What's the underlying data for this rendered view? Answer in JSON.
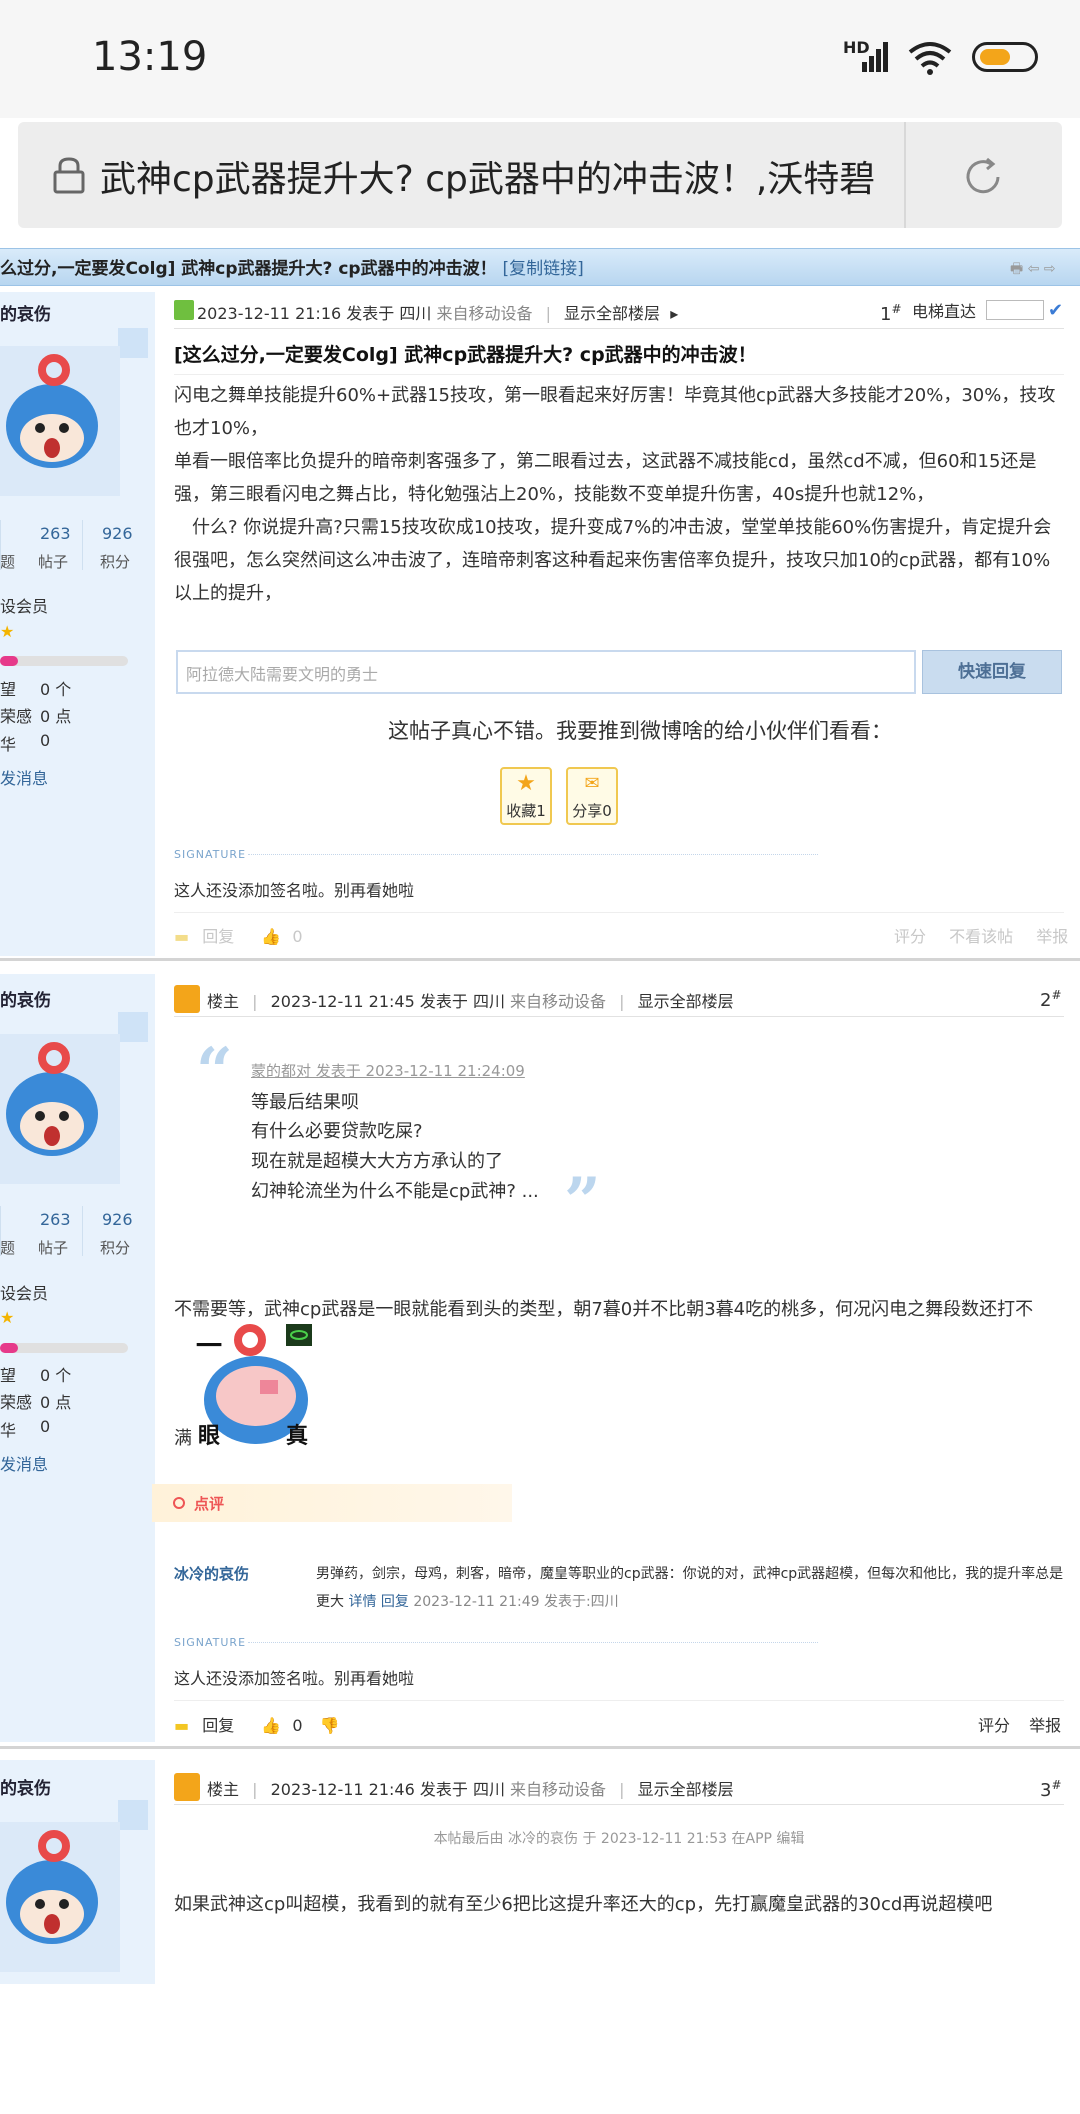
{
  "status_bar": {
    "time": "13:19",
    "network": "HD"
  },
  "browser": {
    "url_title": "武神cp武器提升大? cp武器中的冲击波！,沃特碧",
    "lock_icon": "lock-icon",
    "reload_icon": "reload-icon"
  },
  "title_bar": {
    "title": "么过分,一定要发Colg] 武神cp武器提升大? cp武器中的冲击波！",
    "copy_link": "[复制链接]"
  },
  "post1": {
    "user": {
      "name": "的哀伤",
      "posts_count": "263",
      "posts_label": "帖子",
      "points_count": "926",
      "points_label": "积分",
      "stat_left_label": "题",
      "member": "设会员",
      "row1_label": "望",
      "row1_value": "0 个",
      "row2_label": "荣感",
      "row2_value": "0 点",
      "row3_label": "华",
      "row3_value": "0",
      "send_message": "发消息"
    },
    "meta": {
      "datetime": "2023-12-11 21:16 发表于 四川",
      "device": "来自移动设备",
      "show_all": "显示全部楼层",
      "floor": "1",
      "floor_mark": "#",
      "jump_label": "电梯直达"
    },
    "title": "[这么过分,一定要发Colg] 武神cp武器提升大? cp武器中的冲击波！",
    "paragraphs": [
      "闪电之舞单技能提升60%+武器15技攻，第一眼看起来好厉害！毕竟其他cp武器大多技能才20%，30%，技攻也才10%，",
      "单看一眼倍率比负提升的暗帝刺客强多了，第二眼看过去，这武器不减技能cd，虽然cd不减，但60和15还是强，第三眼看闪电之舞占比，特化勉强沾上20%，技能数不变单提升伤害，40s提升也就12%，",
      "　什么? 你说提升高?只需15技攻砍成10技攻，提升变成7%的冲击波，堂堂单技能60%伤害提升，肯定提升会很强吧，怎么突然间这么冲击波了，连暗帝刺客这种看起来伤害倍率负提升，技攻只加10的cp武器，都有10%以上的提升，"
    ],
    "quick_reply": {
      "placeholder": "阿拉德大陆需要文明的勇士",
      "button": "快速回复"
    },
    "share_prompt": "这帖子真心不错。我要推到微博啥的给小伙伴们看看：",
    "favorite_label": "收藏1",
    "share_label": "分享0",
    "signature_label": "SIGNATURE",
    "signature": "这人还没添加签名啦。别再看她啦",
    "actions": {
      "reply": "回复",
      "likes": "0",
      "rate": "评分",
      "ignore": "不看该帖",
      "report": "举报"
    }
  },
  "post2": {
    "user": {
      "name": "的哀伤",
      "posts_count": "263",
      "posts_label": "帖子",
      "points_count": "926",
      "points_label": "积分",
      "stat_left_label": "题",
      "member": "设会员",
      "row1_label": "望",
      "row1_value": "0 个",
      "row2_label": "荣感",
      "row2_value": "0 点",
      "row3_label": "华",
      "row3_value": "0",
      "send_message": "发消息"
    },
    "meta": {
      "role": "楼主",
      "datetime": "2023-12-11 21:45 发表于 四川",
      "device": "来自移动设备",
      "show_all": "显示全部楼层",
      "floor": "2",
      "floor_mark": "#"
    },
    "quote": {
      "header": "蒙的都对 发表于 2023-12-11 21:24:09",
      "lines": [
        "等最后结果呗",
        "有什么必要贷款吃屎?",
        "现在就是超模大大方方承认的了",
        "幻神轮流坐为什么不能是cp武神? ..."
      ]
    },
    "body": "不需要等，武神cp武器是一眼就能看到头的类型，朝7暮0并不比朝3暮4吃的桃多，何况闪电之舞段数还打不",
    "body_tail": "满",
    "sticker_text": {
      "left": "一",
      "mid": "眼",
      "right": "真"
    },
    "dianping_label": "点评",
    "comment": {
      "user": "冰冷的哀伤",
      "text": "男弹药，剑宗，母鸡，刺客，暗帝，魔皇等职业的cp武器：你说的对，武神cp武器超模，但每次和他比，我的提升率总是更",
      "text_tail": "大",
      "detail": "详情",
      "reply": "回复",
      "time": "2023-12-11 21:49 发表于:四川"
    },
    "signature_label": "SIGNATURE",
    "signature": "这人还没添加签名啦。别再看她啦",
    "actions": {
      "reply": "回复",
      "likes": "0",
      "rate": "评分",
      "report": "举报"
    }
  },
  "post3": {
    "user": {
      "name": "的哀伤"
    },
    "meta": {
      "role": "楼主",
      "datetime": "2023-12-11 21:46 发表于 四川",
      "device": "来自移动设备",
      "show_all": "显示全部楼层",
      "floor": "3",
      "floor_mark": "#"
    },
    "edit_note": "本帖最后由 冰冷的哀伤 于 2023-12-11 21:53 在APP 编辑",
    "body": "如果武神这cp叫超模，我看到的就有至少6把比这提升率还大的cp，先打赢魔皇武器的30cd再说超模吧"
  },
  "colors": {
    "accent": "#336699",
    "title_bar": "#c7dff4",
    "left_column": "#e8f2fc",
    "signature": "#7aa4cc"
  }
}
